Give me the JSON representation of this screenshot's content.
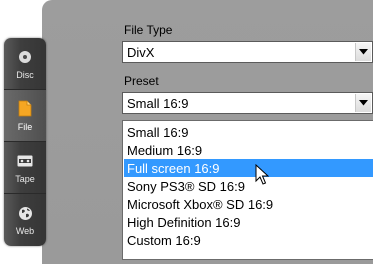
{
  "sidebar": {
    "items": [
      {
        "label": "Disc",
        "icon": "disc-icon"
      },
      {
        "label": "File",
        "icon": "file-icon",
        "active": true
      },
      {
        "label": "Tape",
        "icon": "tape-icon"
      },
      {
        "label": "Web",
        "icon": "globe-icon"
      }
    ]
  },
  "file_type": {
    "label": "File Type",
    "value": "DivX"
  },
  "preset": {
    "label": "Preset",
    "value": "Small 16:9",
    "options": [
      "Small 16:9",
      "Medium 16:9",
      "Full screen 16:9",
      "Sony PS3® SD 16:9",
      "Microsoft Xbox® SD 16:9",
      "High Definition 16:9",
      "Custom 16:9"
    ],
    "highlighted": "Full screen 16:9"
  },
  "colors": {
    "panel_bg": "#9b9b9b",
    "sidebar_bg": "#3e3e3e",
    "highlight": "#3399ff",
    "file_icon": "#f5a623"
  }
}
